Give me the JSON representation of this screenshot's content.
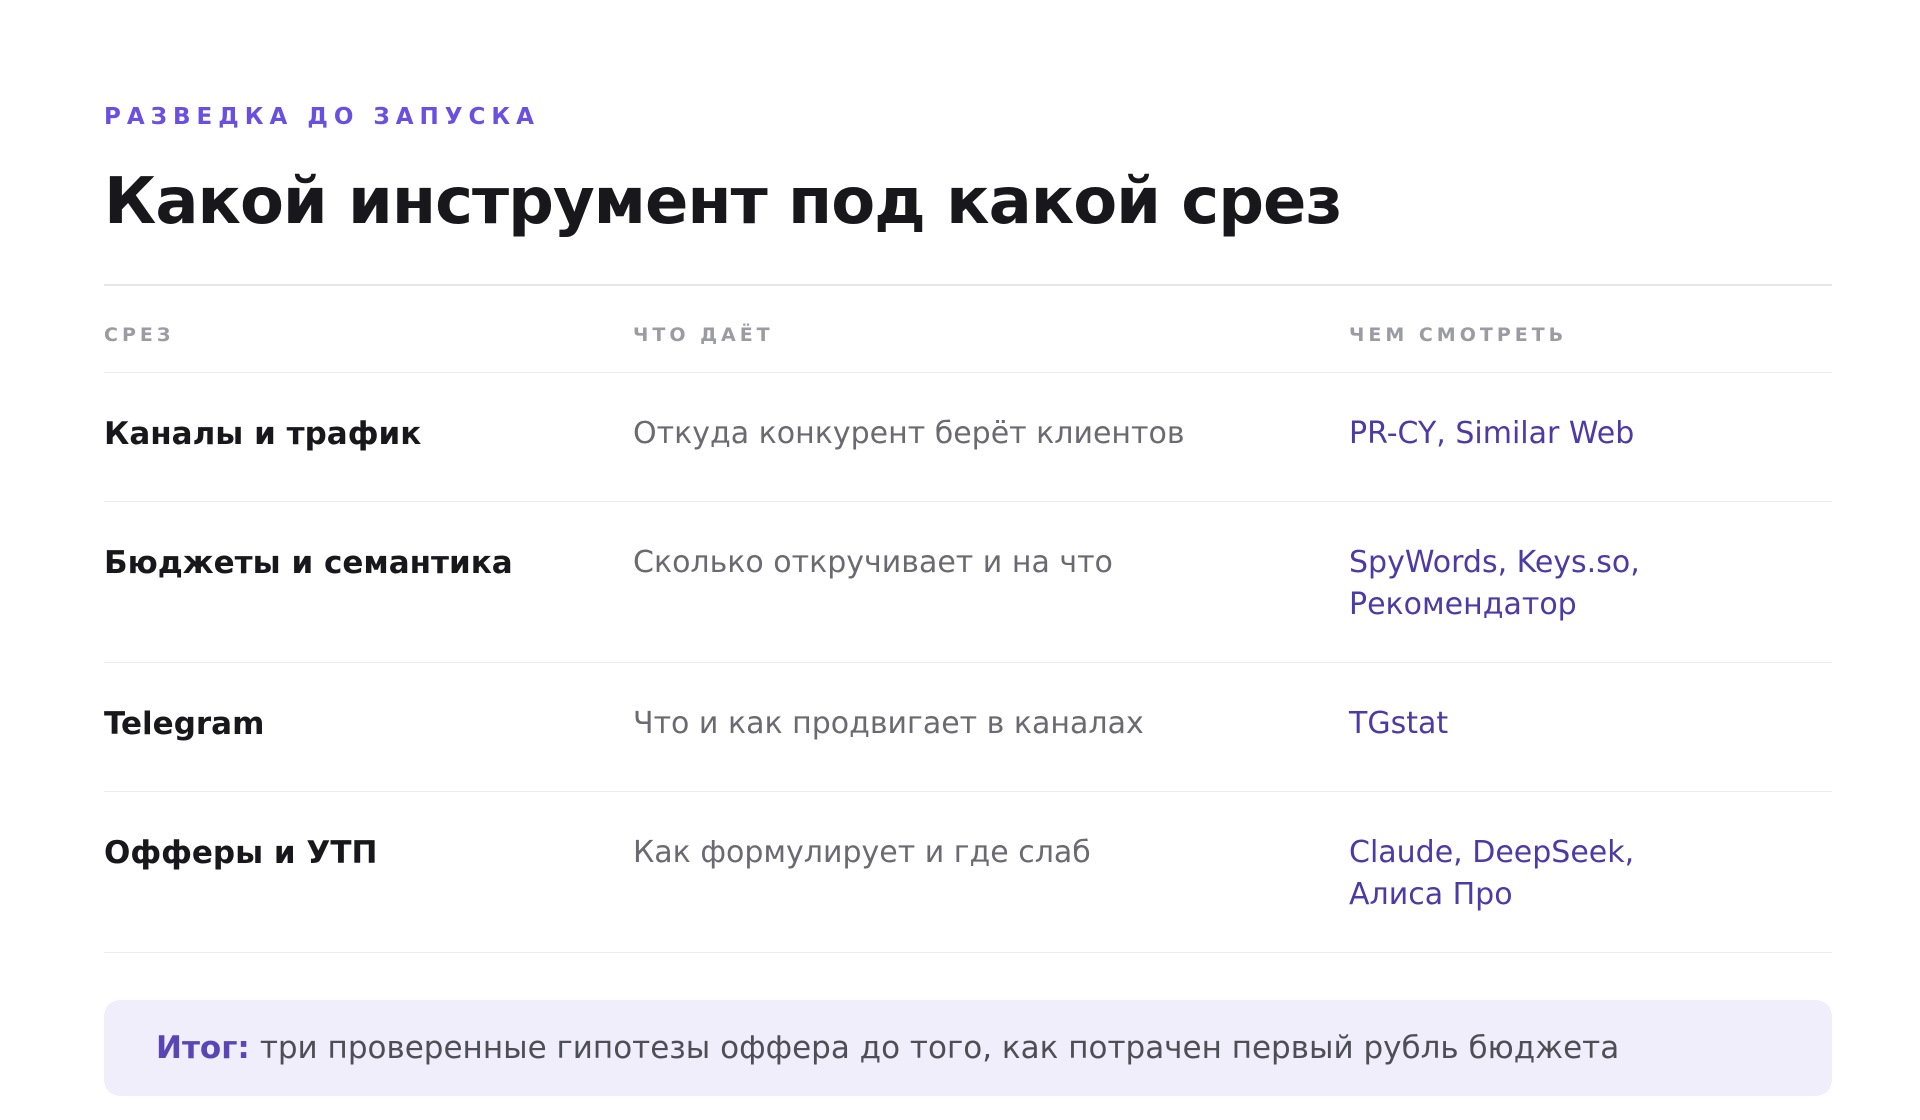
{
  "eyebrow": "РАЗВЕДКА ДО ЗАПУСКА",
  "title": "Какой инструмент под какой срез",
  "table": {
    "headers": [
      "СРЕЗ",
      "ЧТО ДАЁТ",
      "ЧЕМ СМОТРЕТЬ"
    ],
    "rows": [
      {
        "slice": "Каналы и трафик",
        "gives": "Откуда конкурент берёт клиентов",
        "tools": "PR-CY, Similar Web"
      },
      {
        "slice": "Бюджеты и семантика",
        "gives": "Сколько откручивает и на что",
        "tools": "SpyWords, Keys.so, Рекомендатор"
      },
      {
        "slice": "Telegram",
        "gives": "Что и как продвигает в каналах",
        "tools": "TGstat"
      },
      {
        "slice": "Офферы и УТП",
        "gives": "Как формулирует и где слаб",
        "tools": "Claude, DeepSeek, Алиса Про"
      }
    ]
  },
  "summary": {
    "label": "Итог:",
    "text": "три проверенные гипотезы оффера до того, как потрачен первый рубль бюджета"
  },
  "colors": {
    "accent": "#6b4fe0",
    "tool_text": "#4b3ba6",
    "summary_bg": "#f1eefc"
  }
}
